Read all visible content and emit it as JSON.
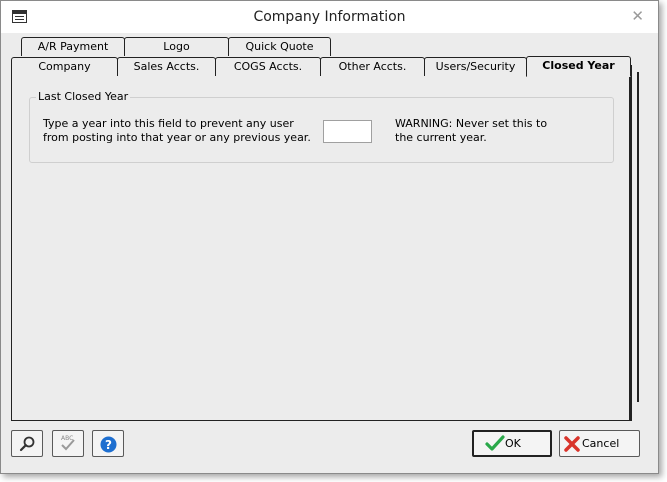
{
  "window": {
    "title": "Company Information"
  },
  "tabs_back": [
    {
      "label": "A/R Payment"
    },
    {
      "label": "Logo"
    },
    {
      "label": "Quick Quote"
    }
  ],
  "tabs_front": [
    {
      "label": "Company"
    },
    {
      "label": "Sales Accts."
    },
    {
      "label": "COGS Accts."
    },
    {
      "label": "Other Accts."
    },
    {
      "label": "Users/Security"
    },
    {
      "label": "Closed Year"
    }
  ],
  "active_tab": "Closed Year",
  "closed_year": {
    "group_title": "Last Closed Year",
    "description": "Type a year into this field to prevent any user from posting into that year or any previous year.",
    "year_value": "",
    "warning": "WARNING: Never set this to the current year."
  },
  "buttons": {
    "ok": "OK",
    "cancel": "Cancel"
  },
  "icons": {
    "search": "search-icon",
    "spellcheck": "spellcheck-icon",
    "help": "help-icon"
  },
  "colors": {
    "ok_check": "#2aa84a",
    "cancel_x": "#d9342b",
    "help_blue": "#1e6fd0"
  }
}
